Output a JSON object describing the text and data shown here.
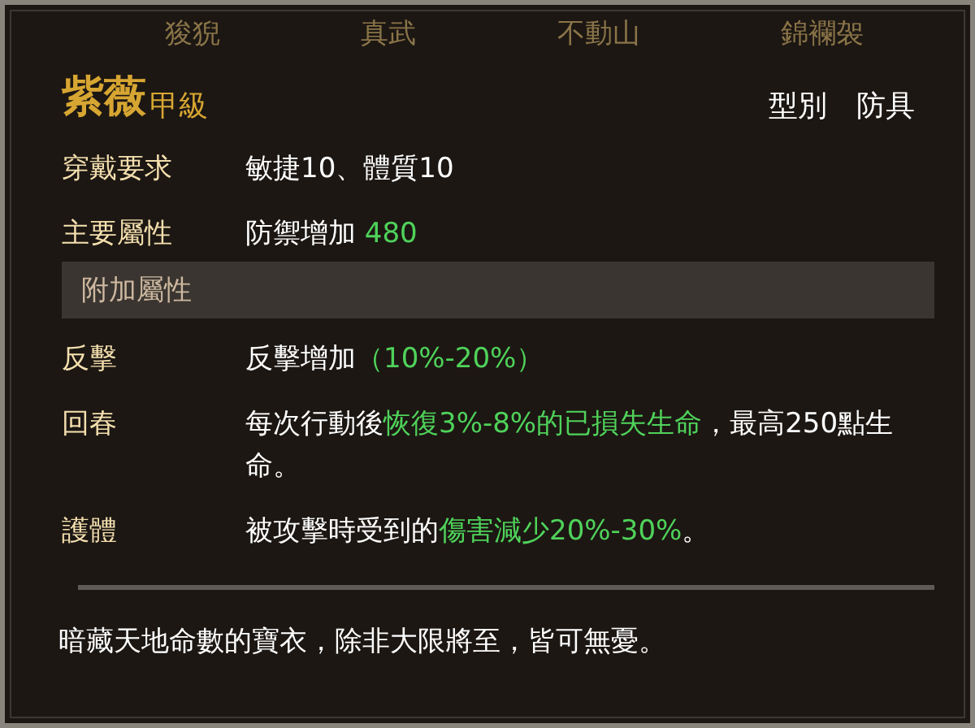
{
  "background_labels": [
    "狻猊",
    "真武",
    "不動山",
    "錦襴袈"
  ],
  "item": {
    "name": "紫薇",
    "grade": "甲級",
    "type_label": "型別",
    "type_value": "防具"
  },
  "requirements": {
    "label": "穿戴要求",
    "value": "敏捷10、體質10"
  },
  "main_attribute": {
    "label": "主要屬性",
    "value": "防禦增加",
    "amount": "480"
  },
  "extra_section": {
    "title": "附加屬性"
  },
  "extra_attributes": [
    {
      "label": "反擊",
      "segments": [
        {
          "text": "反擊增加",
          "highlight": false
        },
        {
          "text": "（10%-20%）",
          "highlight": true
        }
      ]
    },
    {
      "label": "回春",
      "segments": [
        {
          "text": "每次行動後",
          "highlight": false
        },
        {
          "text": "恢復3%-8%的已損失生命",
          "highlight": true
        },
        {
          "text": "，最高250點生命。",
          "highlight": false
        }
      ]
    },
    {
      "label": "護體",
      "segments": [
        {
          "text": "被攻擊時受到的",
          "highlight": false
        },
        {
          "text": "傷害減少20%-30%",
          "highlight": true
        },
        {
          "text": "。",
          "highlight": false
        }
      ]
    }
  ],
  "description": "暗藏天地命數的寶衣，除非大限將至，皆可無憂。"
}
